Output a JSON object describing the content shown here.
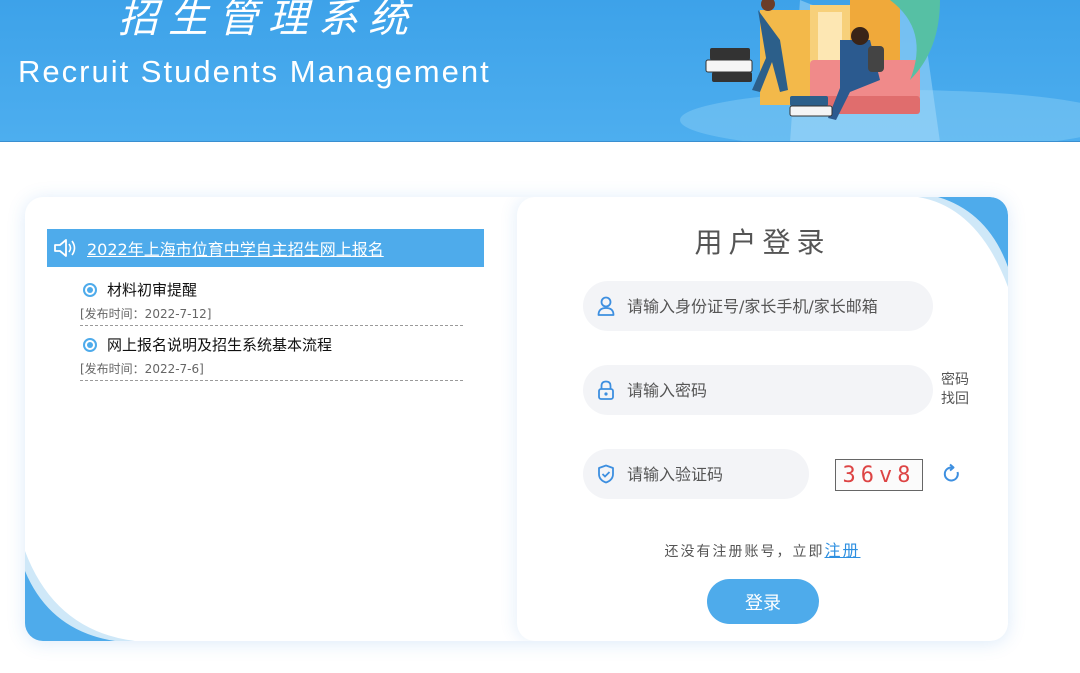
{
  "header": {
    "title_cn": "招生管理系统",
    "title_en": "Recruit Students Management"
  },
  "notices": {
    "heading": "2022年上海市位育中学自主招生网上报名",
    "items": [
      {
        "title": "材料初审提醒",
        "date": "[发布时间：2022-7-12]"
      },
      {
        "title": "网上报名说明及招生系统基本流程",
        "date": "[发布时间：2022-7-6]"
      }
    ]
  },
  "login": {
    "title": "用户登录",
    "username_placeholder": "请输入身份证号/家长手机/家长邮箱",
    "password_placeholder": "请输入密码",
    "forgot_label": "密码找回",
    "captcha_placeholder": "请输入验证码",
    "captcha_text": "36v8",
    "register_prompt": "还没有注册账号，立即",
    "register_link": "注册",
    "submit_label": "登录"
  },
  "colors": {
    "accent": "#4eabeb",
    "banner": "#3da2e9",
    "link": "#2d8fe0"
  },
  "icons": [
    "speaker-icon",
    "user-icon",
    "lock-icon",
    "shield-icon",
    "refresh-icon"
  ]
}
